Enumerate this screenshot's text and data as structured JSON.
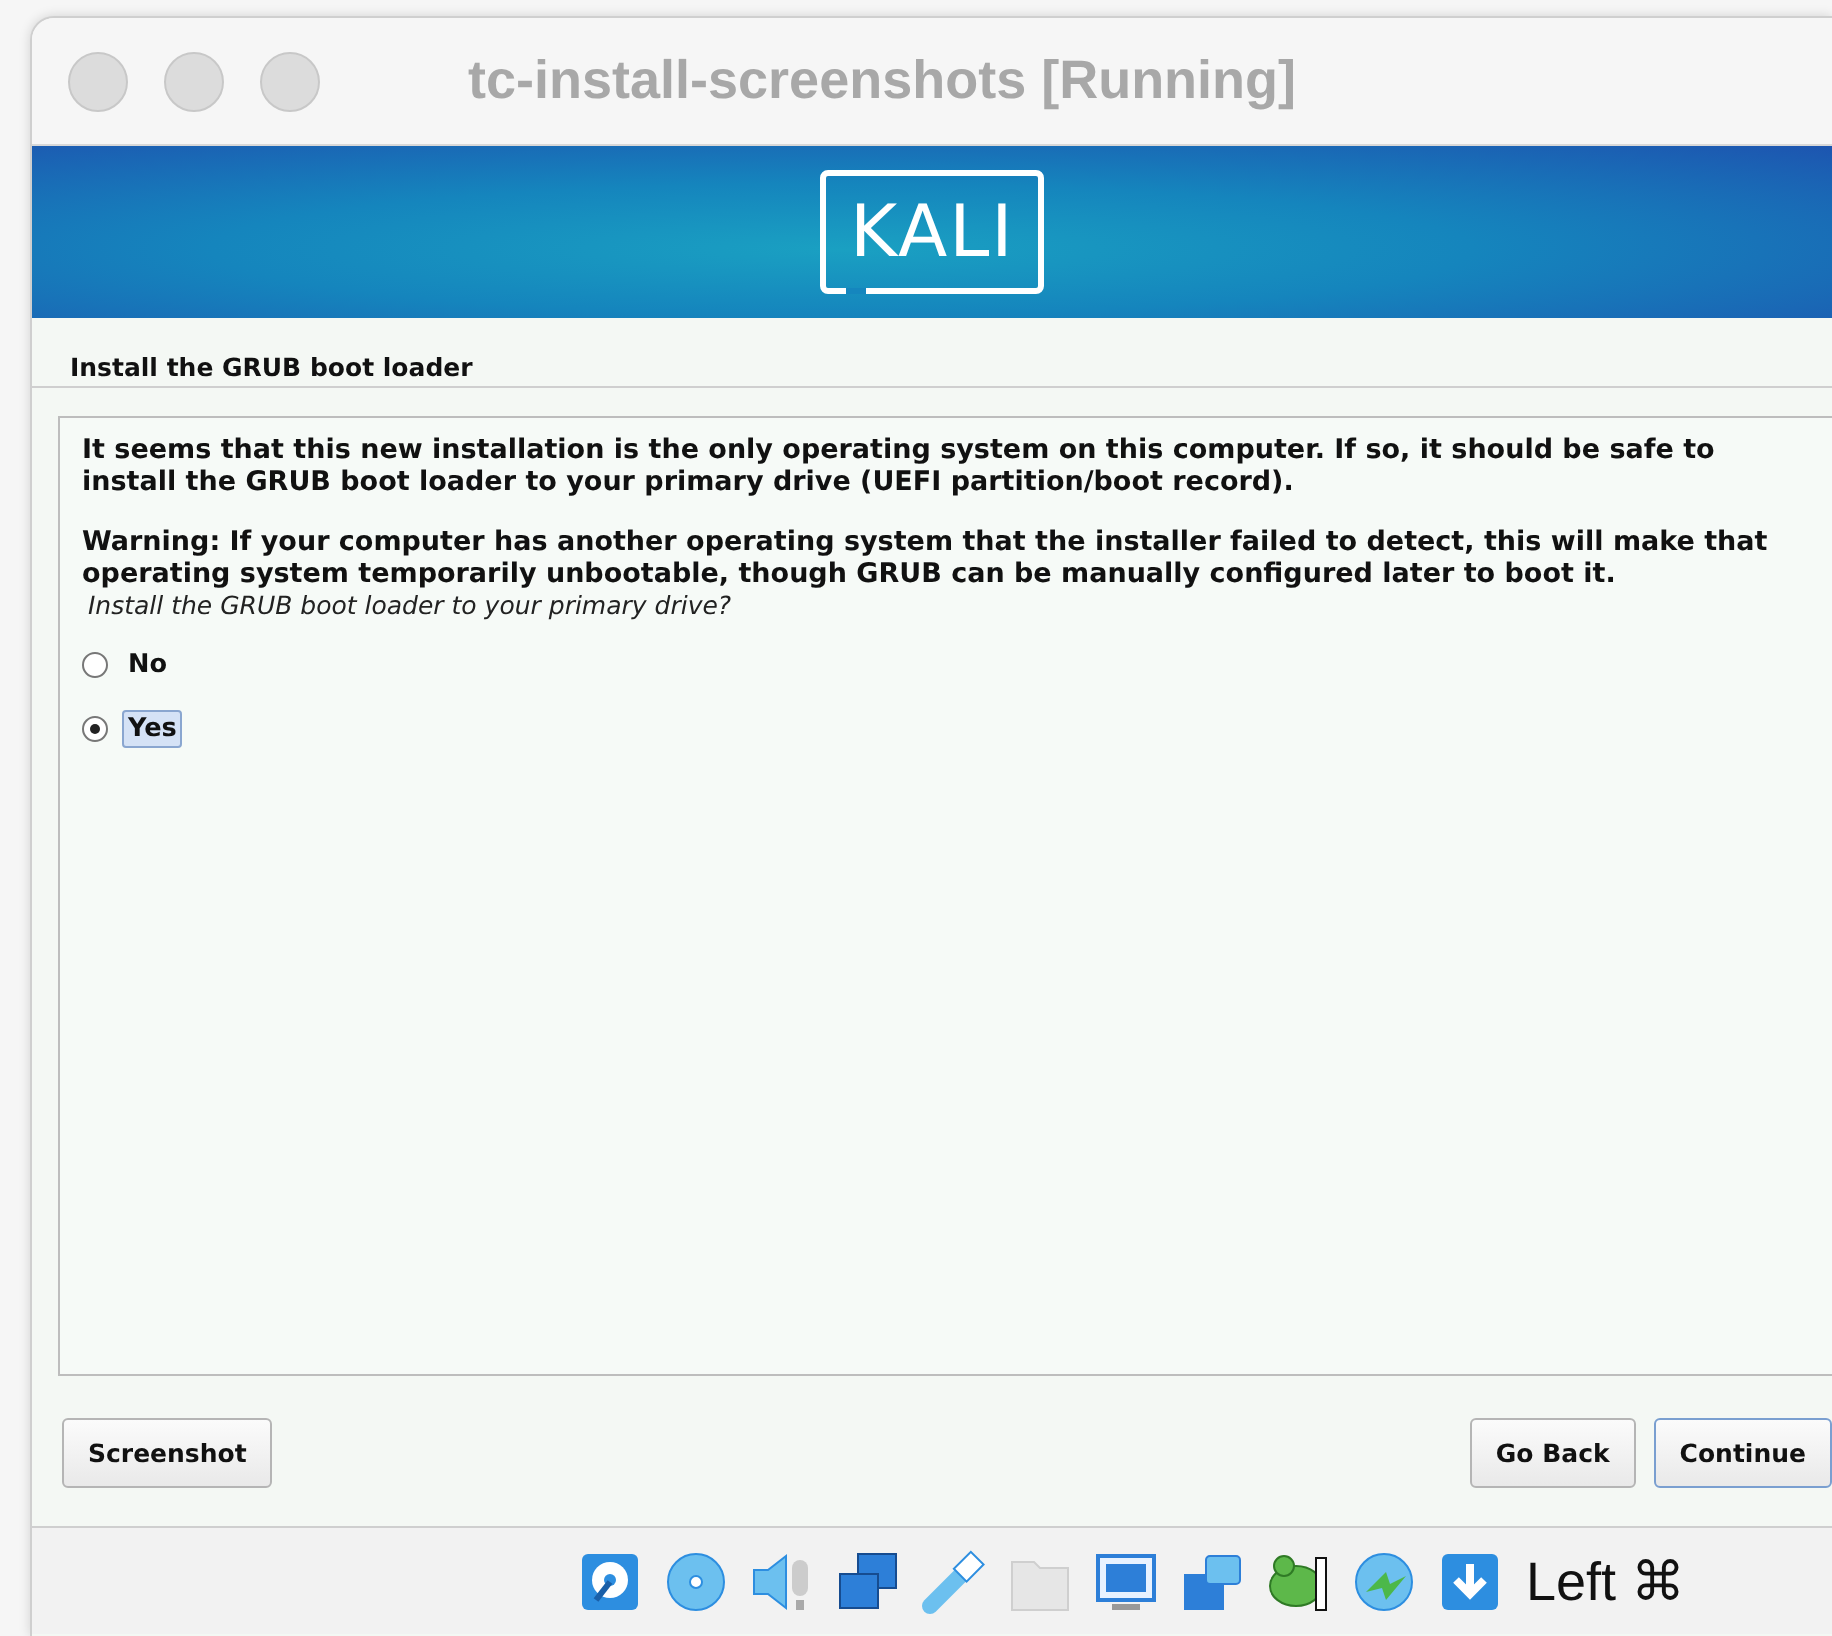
{
  "window": {
    "title": "tc-install-screenshots [Running]"
  },
  "banner": {
    "logo": "KALI"
  },
  "step_title": "Install the GRUB boot loader",
  "paragraphs": [
    "It seems that this new installation is the only operating system on this computer. If so, it should be safe to install the GRUB boot loader to your primary drive (UEFI partition/boot record).",
    "Warning: If your computer has another operating system that the installer failed to detect, this will make that operating system temporarily unbootable, though GRUB can be manually configured later to boot it."
  ],
  "question": "Install the GRUB boot loader to your primary drive?",
  "options": [
    {
      "label": "No",
      "selected": false
    },
    {
      "label": "Yes",
      "selected": true
    }
  ],
  "buttons": {
    "left": "Screenshot",
    "back": "Go Back",
    "continue": "Continue"
  },
  "status_bar": {
    "host_key": "Left ⌘"
  }
}
